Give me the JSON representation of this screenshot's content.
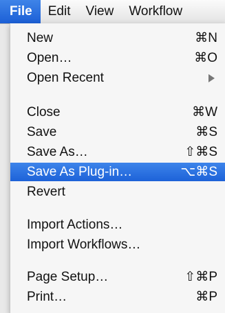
{
  "menubar": {
    "items": [
      {
        "label": "File",
        "active": true
      },
      {
        "label": "Edit",
        "active": false
      },
      {
        "label": "View",
        "active": false
      },
      {
        "label": "Workflow",
        "active": false
      }
    ]
  },
  "file_menu": {
    "new": {
      "label": "New",
      "shortcut": "⌘N"
    },
    "open": {
      "label": "Open…",
      "shortcut": "⌘O"
    },
    "open_recent": {
      "label": "Open Recent",
      "icon": "submenu-arrow-icon"
    },
    "close": {
      "label": "Close",
      "shortcut": "⌘W"
    },
    "save": {
      "label": "Save",
      "shortcut": "⌘S"
    },
    "save_as": {
      "label": "Save As…",
      "shortcut": "⇧⌘S"
    },
    "save_as_plugin": {
      "label": "Save As Plug-in…",
      "shortcut": "⌥⌘S"
    },
    "revert": {
      "label": "Revert"
    },
    "import_actions": {
      "label": "Import Actions…"
    },
    "import_workflows": {
      "label": "Import Workflows…"
    },
    "page_setup": {
      "label": "Page Setup…",
      "shortcut": "⇧⌘P"
    },
    "print": {
      "label": "Print…",
      "shortcut": "⌘P"
    }
  },
  "colors": {
    "highlight": "#1d62d8",
    "menu_bg": "#f6f6f6"
  }
}
